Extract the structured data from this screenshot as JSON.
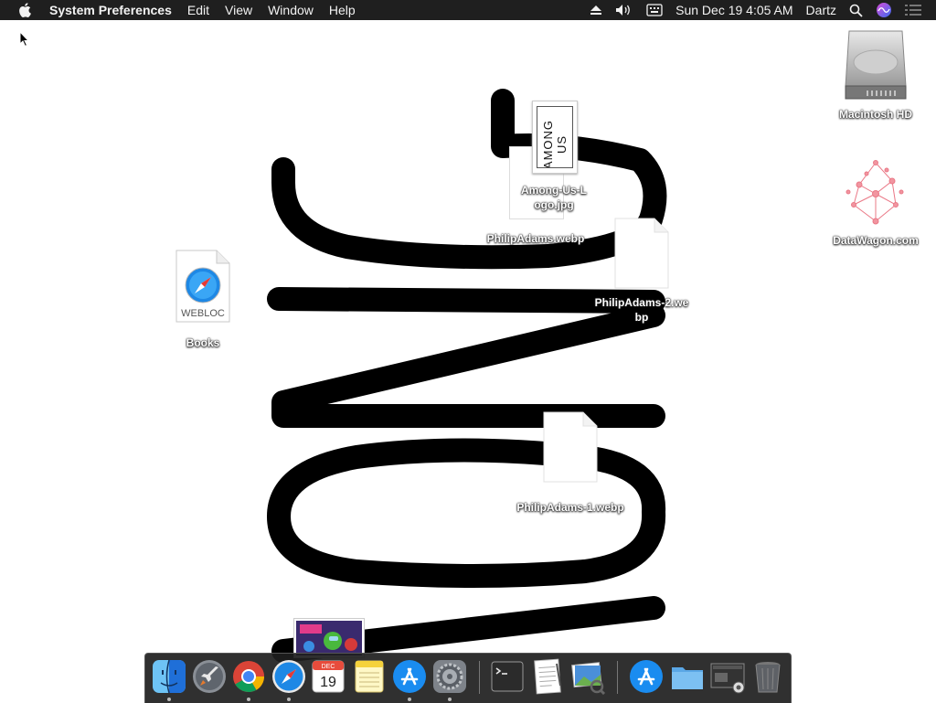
{
  "menubar": {
    "app_name": "System Preferences",
    "menus": [
      "Edit",
      "View",
      "Window",
      "Help"
    ],
    "date_time": "Sun Dec 19  4:05 AM",
    "user": "Dartz"
  },
  "desktop": {
    "macintosh_hd": "Macintosh HD",
    "datawagon": "DataWagon.com",
    "books": "Books",
    "webloc_badge": "WEBLOC",
    "among_us_logo": "Among-Us-Logo.jpg",
    "among_us_preview_text": "AMONG US",
    "philip_webp": "PhilipAdams.webp",
    "philip2_webp": "PhilipAdams-2.webp",
    "philip1_webp": "PhilipAdams-1.webp"
  },
  "dock": {
    "calendar_month": "DEC",
    "calendar_day": "19",
    "items": [
      "Finder",
      "Launchpad",
      "Google Chrome",
      "Safari",
      "Calendar",
      "Notes",
      "App Store",
      "System Preferences",
      "Terminal",
      "TextEdit",
      "Preview",
      "App Store",
      "Downloads",
      "Screenshot",
      "Trash"
    ]
  },
  "colors": {
    "menubar_bg": "#1f1f1f",
    "dock_bg": "#1e1e1e",
    "safari_blue": "#1e88e5",
    "chrome_red": "#db4437",
    "chrome_green": "#0f9d58",
    "chrome_yellow": "#f4b400"
  }
}
